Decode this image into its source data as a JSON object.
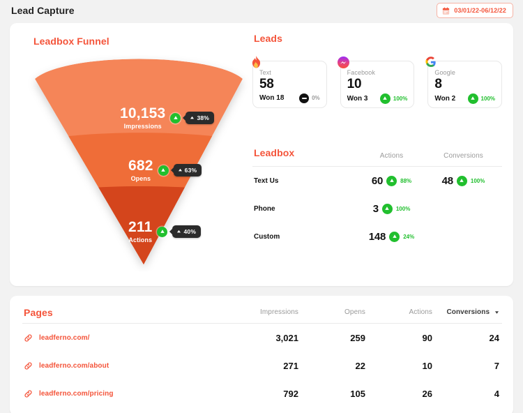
{
  "header": {
    "title": "Lead Capture",
    "date_range": "03/01/22-06/12/22",
    "calendar_icon": "calendar-icon"
  },
  "funnel": {
    "title": "Leadbox Funnel",
    "colors": {
      "top": "#f58559",
      "middle": "#ef6d37",
      "bottom": "#d4441e"
    },
    "stages": [
      {
        "value": "10,153",
        "label": "Impressions",
        "delta": "38%",
        "direction": "up"
      },
      {
        "value": "682",
        "label": "Opens",
        "delta": "63%",
        "direction": "up"
      },
      {
        "value": "211",
        "label": "Actions",
        "delta": "40%",
        "direction": "up"
      }
    ]
  },
  "leads": {
    "title": "Leads",
    "cards": [
      {
        "icon": "flame-icon",
        "name": "Text",
        "value": "58",
        "won": "Won 18",
        "delta": "0%",
        "direction": "flat"
      },
      {
        "icon": "messenger-icon",
        "name": "Facebook",
        "value": "10",
        "won": "Won 3",
        "delta": "100%",
        "direction": "up"
      },
      {
        "icon": "google-icon",
        "name": "Google",
        "value": "8",
        "won": "Won 2",
        "delta": "100%",
        "direction": "up"
      }
    ]
  },
  "leadbox": {
    "title": "Leadbox",
    "columns": [
      "Actions",
      "Conversions"
    ],
    "rows": [
      {
        "name": "Text Us",
        "actions": "60",
        "actions_delta": "88%",
        "conversions": "48",
        "conversions_delta": "100%"
      },
      {
        "name": "Phone",
        "actions": "3",
        "actions_delta": "100%",
        "conversions": "",
        "conversions_delta": ""
      },
      {
        "name": "Custom",
        "actions": "148",
        "actions_delta": "24%",
        "conversions": "",
        "conversions_delta": ""
      }
    ]
  },
  "pages": {
    "title": "Pages",
    "columns": [
      "Impressions",
      "Opens",
      "Actions",
      "Conversions"
    ],
    "sorted_by": "Conversions",
    "sort_direction": "desc",
    "rows": [
      {
        "url": "leadferno.com/",
        "impressions": "3,021",
        "opens": "259",
        "actions": "90",
        "conversions": "24"
      },
      {
        "url": "leadferno.com/about",
        "impressions": "271",
        "opens": "22",
        "actions": "10",
        "conversions": "7"
      },
      {
        "url": "leadferno.com/pricing",
        "impressions": "792",
        "opens": "105",
        "actions": "26",
        "conversions": "4"
      }
    ]
  },
  "chart_data": {
    "type": "funnel",
    "title": "Leadbox Funnel",
    "categories": [
      "Impressions",
      "Opens",
      "Actions"
    ],
    "values": [
      10153,
      682,
      211
    ],
    "deltas": [
      "38%",
      "63%",
      "40%"
    ]
  }
}
